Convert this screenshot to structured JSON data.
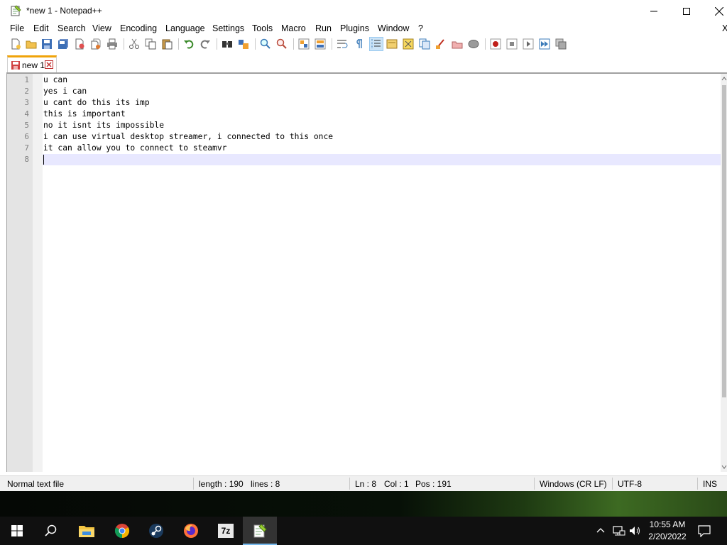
{
  "window": {
    "title": "*new 1 - Notepad++"
  },
  "menu": {
    "items": [
      "File",
      "Edit",
      "Search",
      "View",
      "Encoding",
      "Language",
      "Settings",
      "Tools",
      "Macro",
      "Run",
      "Plugins",
      "Window",
      "?"
    ],
    "close_glyph": "X"
  },
  "tabs": [
    {
      "label": "new 1",
      "unsaved": true
    }
  ],
  "editor": {
    "line_numbers": [
      "1",
      "2",
      "3",
      "4",
      "5",
      "6",
      "7",
      "8"
    ],
    "lines": [
      "u can",
      "yes i can",
      "u cant do this its imp",
      "this is important",
      "no it isnt its impossible",
      "i can use virtual desktop streamer, i connected to this once",
      "it can allow you to connect to steamvr",
      ""
    ],
    "current_line_color": "#e8e8ff"
  },
  "statusbar": {
    "file_type": "Normal text file",
    "length": "length : 190",
    "lines": "lines : 8",
    "ln": "Ln : 8",
    "col": "Col : 1",
    "pos": "Pos : 191",
    "eol": "Windows (CR LF)",
    "encoding": "UTF-8",
    "mode": "INS"
  },
  "taskbar": {
    "apps": [
      "start-icon",
      "search-icon",
      "file-explorer-icon",
      "chrome-icon",
      "steam-icon",
      "firefox-icon",
      "7zip-icon",
      "notepadpp-icon"
    ],
    "sevenzip_label": "7z",
    "active_app": "notepadpp-icon",
    "time": "10:55 AM",
    "date": "2/20/2022"
  },
  "colors": {
    "tab_accent": "#f0a30a",
    "taskbar_bg": "#101010",
    "taskbar_active_underline": "#76b9ed"
  }
}
